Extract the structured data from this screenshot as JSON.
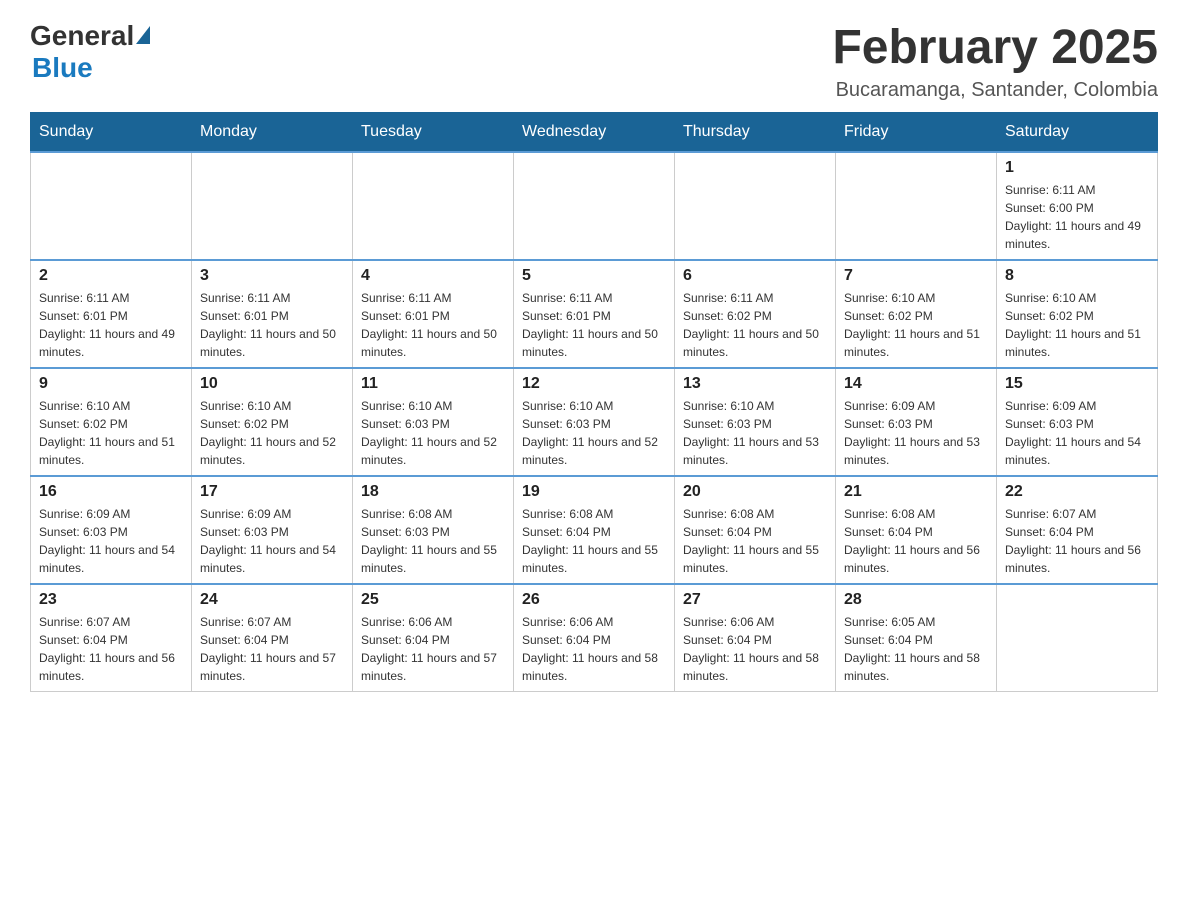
{
  "header": {
    "logo_general": "General",
    "logo_blue": "Blue",
    "title": "February 2025",
    "location": "Bucaramanga, Santander, Colombia"
  },
  "days_of_week": [
    "Sunday",
    "Monday",
    "Tuesday",
    "Wednesday",
    "Thursday",
    "Friday",
    "Saturday"
  ],
  "weeks": [
    [
      {
        "day": "",
        "info": ""
      },
      {
        "day": "",
        "info": ""
      },
      {
        "day": "",
        "info": ""
      },
      {
        "day": "",
        "info": ""
      },
      {
        "day": "",
        "info": ""
      },
      {
        "day": "",
        "info": ""
      },
      {
        "day": "1",
        "info": "Sunrise: 6:11 AM\nSunset: 6:00 PM\nDaylight: 11 hours and 49 minutes."
      }
    ],
    [
      {
        "day": "2",
        "info": "Sunrise: 6:11 AM\nSunset: 6:01 PM\nDaylight: 11 hours and 49 minutes."
      },
      {
        "day": "3",
        "info": "Sunrise: 6:11 AM\nSunset: 6:01 PM\nDaylight: 11 hours and 50 minutes."
      },
      {
        "day": "4",
        "info": "Sunrise: 6:11 AM\nSunset: 6:01 PM\nDaylight: 11 hours and 50 minutes."
      },
      {
        "day": "5",
        "info": "Sunrise: 6:11 AM\nSunset: 6:01 PM\nDaylight: 11 hours and 50 minutes."
      },
      {
        "day": "6",
        "info": "Sunrise: 6:11 AM\nSunset: 6:02 PM\nDaylight: 11 hours and 50 minutes."
      },
      {
        "day": "7",
        "info": "Sunrise: 6:10 AM\nSunset: 6:02 PM\nDaylight: 11 hours and 51 minutes."
      },
      {
        "day": "8",
        "info": "Sunrise: 6:10 AM\nSunset: 6:02 PM\nDaylight: 11 hours and 51 minutes."
      }
    ],
    [
      {
        "day": "9",
        "info": "Sunrise: 6:10 AM\nSunset: 6:02 PM\nDaylight: 11 hours and 51 minutes."
      },
      {
        "day": "10",
        "info": "Sunrise: 6:10 AM\nSunset: 6:02 PM\nDaylight: 11 hours and 52 minutes."
      },
      {
        "day": "11",
        "info": "Sunrise: 6:10 AM\nSunset: 6:03 PM\nDaylight: 11 hours and 52 minutes."
      },
      {
        "day": "12",
        "info": "Sunrise: 6:10 AM\nSunset: 6:03 PM\nDaylight: 11 hours and 52 minutes."
      },
      {
        "day": "13",
        "info": "Sunrise: 6:10 AM\nSunset: 6:03 PM\nDaylight: 11 hours and 53 minutes."
      },
      {
        "day": "14",
        "info": "Sunrise: 6:09 AM\nSunset: 6:03 PM\nDaylight: 11 hours and 53 minutes."
      },
      {
        "day": "15",
        "info": "Sunrise: 6:09 AM\nSunset: 6:03 PM\nDaylight: 11 hours and 54 minutes."
      }
    ],
    [
      {
        "day": "16",
        "info": "Sunrise: 6:09 AM\nSunset: 6:03 PM\nDaylight: 11 hours and 54 minutes."
      },
      {
        "day": "17",
        "info": "Sunrise: 6:09 AM\nSunset: 6:03 PM\nDaylight: 11 hours and 54 minutes."
      },
      {
        "day": "18",
        "info": "Sunrise: 6:08 AM\nSunset: 6:03 PM\nDaylight: 11 hours and 55 minutes."
      },
      {
        "day": "19",
        "info": "Sunrise: 6:08 AM\nSunset: 6:04 PM\nDaylight: 11 hours and 55 minutes."
      },
      {
        "day": "20",
        "info": "Sunrise: 6:08 AM\nSunset: 6:04 PM\nDaylight: 11 hours and 55 minutes."
      },
      {
        "day": "21",
        "info": "Sunrise: 6:08 AM\nSunset: 6:04 PM\nDaylight: 11 hours and 56 minutes."
      },
      {
        "day": "22",
        "info": "Sunrise: 6:07 AM\nSunset: 6:04 PM\nDaylight: 11 hours and 56 minutes."
      }
    ],
    [
      {
        "day": "23",
        "info": "Sunrise: 6:07 AM\nSunset: 6:04 PM\nDaylight: 11 hours and 56 minutes."
      },
      {
        "day": "24",
        "info": "Sunrise: 6:07 AM\nSunset: 6:04 PM\nDaylight: 11 hours and 57 minutes."
      },
      {
        "day": "25",
        "info": "Sunrise: 6:06 AM\nSunset: 6:04 PM\nDaylight: 11 hours and 57 minutes."
      },
      {
        "day": "26",
        "info": "Sunrise: 6:06 AM\nSunset: 6:04 PM\nDaylight: 11 hours and 58 minutes."
      },
      {
        "day": "27",
        "info": "Sunrise: 6:06 AM\nSunset: 6:04 PM\nDaylight: 11 hours and 58 minutes."
      },
      {
        "day": "28",
        "info": "Sunrise: 6:05 AM\nSunset: 6:04 PM\nDaylight: 11 hours and 58 minutes."
      },
      {
        "day": "",
        "info": ""
      }
    ]
  ]
}
